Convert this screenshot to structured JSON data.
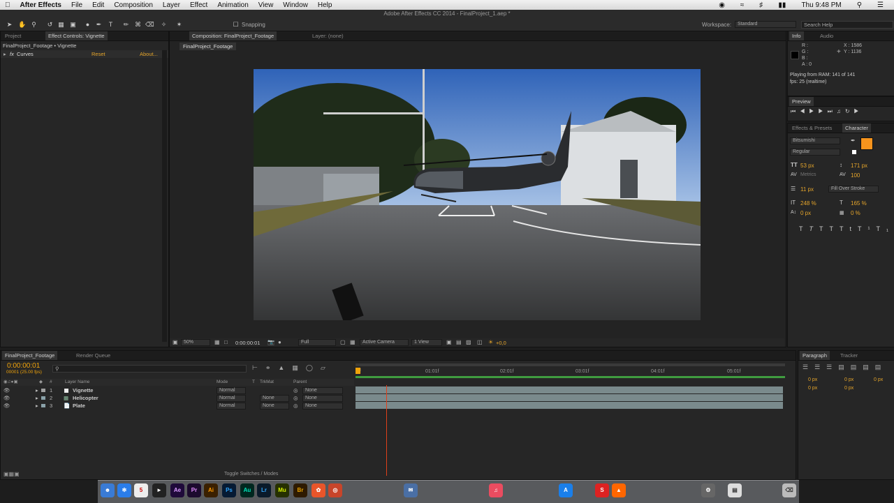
{
  "menubar": {
    "app": "After Effects",
    "items": [
      "File",
      "Edit",
      "Composition",
      "Layer",
      "Effect",
      "Animation",
      "View",
      "Window",
      "Help"
    ],
    "clock": "Thu 9:48 PM"
  },
  "window": {
    "title": "Adobe After Effects CC 2014 - FinalProject_1.aep *"
  },
  "toolbar": {
    "snapping": "Snapping",
    "workspace_label": "Workspace:",
    "workspace_value": "Standard",
    "search_placeholder": "Search Help"
  },
  "left_panel": {
    "tab_project": "Project",
    "tab_effect_controls": "Effect Controls: Vignette",
    "breadcrumb": "FinalProject_Footage • Vignette",
    "effect_name": "Curves",
    "reset": "Reset",
    "about": "About..."
  },
  "comp_panel": {
    "tab_comp": "Composition: FinalProject_Footage",
    "tab_layer": "Layer: (none)",
    "subtab": "FinalProject_Footage",
    "zoom": "50%",
    "timecode": "0:00:00:01",
    "resolution": "Full",
    "camera": "Active Camera",
    "views": "1 View",
    "exposure": "+0,0"
  },
  "info_panel": {
    "tab_info": "Info",
    "tab_audio": "Audio",
    "r": "R :",
    "g": "G :",
    "b": "B :",
    "a": "A : 0",
    "x": "X : 1586",
    "y": "Y : 1136",
    "ram": "Playing from RAM: 141 of 141",
    "fps": "fps: 25 (realtime)"
  },
  "preview_panel": {
    "tab": "Preview"
  },
  "character_panel": {
    "tab_effects": "Effects & Presets",
    "tab_character": "Character",
    "font": "Bitsumishi",
    "style": "Regular",
    "size": "53 px",
    "leading": "171 px",
    "kerning": "Metrics",
    "tracking": "100",
    "stroke": "11 px",
    "stroke_mode": "Fill Over Stroke",
    "vscale": "248 %",
    "hscale": "165 %",
    "baseline": "0 px",
    "tsume": "0 %",
    "fill_color": "#f7941d"
  },
  "timeline": {
    "tab_comp": "FinalProject_Footage",
    "tab_render": "Render Queue",
    "timecode": "0:00:00:01",
    "frames": "00001 (25.00 fps)",
    "columns": {
      "num": "#",
      "layer_name": "Layer Name",
      "mode": "Mode",
      "t": "T",
      "trkmat": "TrkMat",
      "parent": "Parent"
    },
    "layers": [
      {
        "num": "1",
        "name": "Vignette",
        "mode": "Normal",
        "trkmat": "",
        "parent": "None"
      },
      {
        "num": "2",
        "name": "Helicopter",
        "mode": "Normal",
        "trkmat": "None",
        "parent": "None"
      },
      {
        "num": "3",
        "name": "Plate",
        "mode": "Normal",
        "trkmat": "None",
        "parent": "None"
      }
    ],
    "ruler": [
      "0f",
      "01:01f",
      "02:01f",
      "03:01f",
      "04:01f",
      "05:01f"
    ],
    "toggle": "Toggle Switches / Modes"
  },
  "paragraph_panel": {
    "tab_paragraph": "Paragraph",
    "tab_tracker": "Tracker",
    "indent_left": "0 px",
    "indent_right": "0 px",
    "indent_first": "0 px",
    "space_before": "0 px",
    "space_after": "0 px"
  },
  "dock": {
    "apps": [
      "Ae",
      "Pr",
      "Ai",
      "Ps",
      "Au",
      "Lr",
      "Mu",
      "Br"
    ]
  },
  "colors": {
    "accent": "#e5a52b",
    "timecode": "#f0a30a"
  }
}
